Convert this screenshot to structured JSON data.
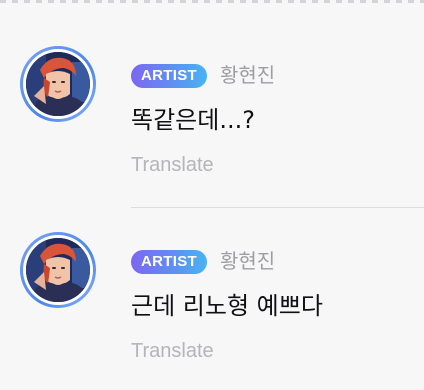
{
  "posts": [
    {
      "badge": "ARTIST",
      "username": "황현진",
      "message": "똑같은데...?",
      "translate_label": "Translate"
    },
    {
      "badge": "ARTIST",
      "username": "황현진",
      "message": "근데 리노형 예쁘다",
      "translate_label": "Translate"
    }
  ],
  "colors": {
    "background": "#f7f7f8",
    "badge_gradient_start": "#7c67f2",
    "badge_gradient_end": "#48b4f2",
    "avatar_ring": "#4b86e8",
    "username": "#9d9da3",
    "message": "#111114",
    "translate": "#b4b4b9",
    "divider": "#dddde0"
  },
  "icons": {
    "avatar": "artist-profile-photo"
  }
}
